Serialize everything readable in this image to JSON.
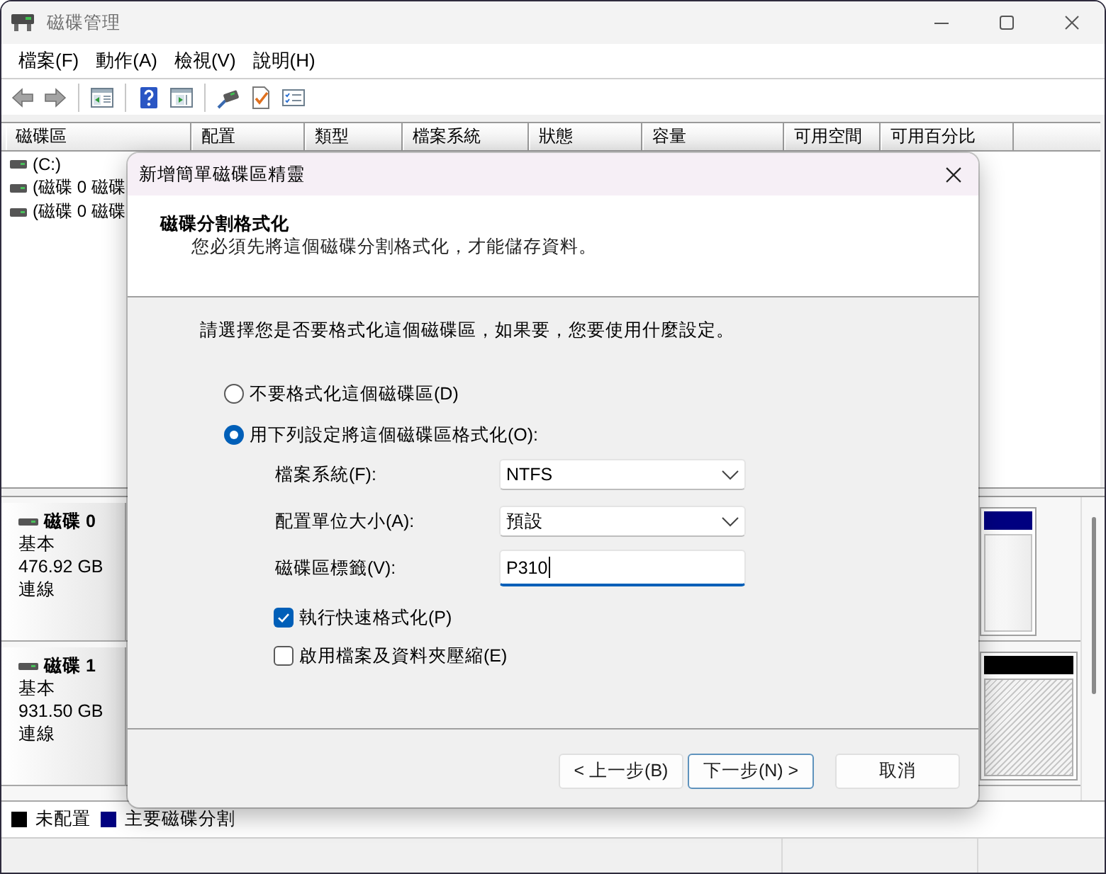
{
  "window": {
    "title": "磁碟管理"
  },
  "menu": [
    {
      "label": "檔案(F)"
    },
    {
      "label": "動作(A)"
    },
    {
      "label": "檢視(V)"
    },
    {
      "label": "說明(H)"
    }
  ],
  "volume_table": {
    "columns": [
      "磁碟區",
      "配置",
      "類型",
      "檔案系統",
      "狀態",
      "容量",
      "可用空間",
      "可用百分比"
    ],
    "rows": [
      {
        "name": "(C:)"
      },
      {
        "name": "(磁碟 0 磁碟"
      },
      {
        "name": "(磁碟 0 磁碟"
      }
    ]
  },
  "disks": [
    {
      "name": "磁碟 0",
      "type": "基本",
      "size": "476.92 GB",
      "status": "連線",
      "partitions": [
        {
          "kind": "primary"
        }
      ]
    },
    {
      "name": "磁碟 1",
      "type": "基本",
      "size": "931.50 GB",
      "status": "連線",
      "partitions": [
        {
          "kind": "unallocated"
        }
      ]
    }
  ],
  "legend": [
    {
      "label": "未配置",
      "color": "#000000"
    },
    {
      "label": "主要磁碟分割",
      "color": "#000080"
    }
  ],
  "dialog": {
    "title": "新增簡單磁碟區精靈",
    "heading": "磁碟分割格式化",
    "subheading": "您必須先將這個磁碟分割格式化，才能儲存資料。",
    "instruction": "請選擇您是否要格式化這個磁碟區，如果要，您要使用什麼設定。",
    "options": [
      {
        "label": "不要格式化這個磁碟區(D)",
        "selected": false
      },
      {
        "label": "用下列設定將這個磁碟區格式化(O):",
        "selected": true
      }
    ],
    "fields": [
      {
        "kind": "dropdown",
        "label": "檔案系統(F):",
        "value": "NTFS",
        "focused": false
      },
      {
        "kind": "dropdown",
        "label": "配置單位大小(A):",
        "value": "預設",
        "focused": false
      },
      {
        "kind": "text",
        "label": "磁碟區標籤(V):",
        "value": "P310",
        "focused": true
      }
    ],
    "checkboxes": [
      {
        "label": "執行快速格式化(P)",
        "checked": true
      },
      {
        "label": "啟用檔案及資料夾壓縮(E)",
        "checked": false
      }
    ],
    "buttons": [
      {
        "label": "< 上一步(B)",
        "default": false
      },
      {
        "label": "下一步(N) >",
        "default": true
      },
      {
        "label": "取消",
        "default": false
      }
    ]
  }
}
